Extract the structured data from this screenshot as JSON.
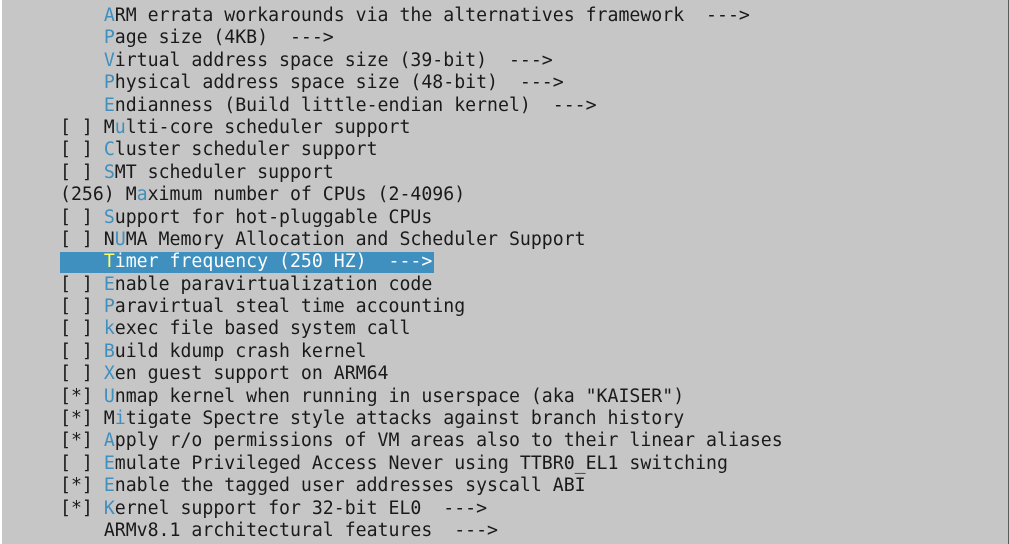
{
  "colors": {
    "background": "#c6c6c6",
    "text": "#1a1a1a",
    "hotkey": "#3f8fbf",
    "selection": "#3f8fbf",
    "selection_text": "#ffffff",
    "selection_hotkey": "#ffff66"
  },
  "items": [
    {
      "prefix": "    ",
      "hot": "A",
      "rest": "RM errata workarounds via the alternatives framework  --->",
      "selected": false
    },
    {
      "prefix": "    ",
      "hot": "P",
      "rest": "age size (4KB)  --->",
      "selected": false
    },
    {
      "prefix": "    ",
      "hot": "V",
      "rest": "irtual address space size (39-bit)  --->",
      "selected": false
    },
    {
      "prefix": "    ",
      "hot": "P",
      "rest": "hysical address space size (48-bit)  --->",
      "selected": false
    },
    {
      "prefix": "    ",
      "hot": "E",
      "rest": "ndianness (Build little-endian kernel)  --->",
      "selected": false
    },
    {
      "prefix": "[ ] M",
      "hot": "u",
      "rest": "lti-core scheduler support",
      "selected": false
    },
    {
      "prefix": "[ ] ",
      "hot": "C",
      "rest": "luster scheduler support",
      "selected": false
    },
    {
      "prefix": "[ ] ",
      "hot": "S",
      "rest": "MT scheduler support",
      "selected": false
    },
    {
      "prefix": "(256) M",
      "hot": "a",
      "rest": "ximum number of CPUs (2-4096)",
      "selected": false
    },
    {
      "prefix": "[ ] ",
      "hot": "S",
      "rest": "upport for hot-pluggable CPUs",
      "selected": false
    },
    {
      "prefix": "[ ] N",
      "hot": "U",
      "rest": "MA Memory Allocation and Scheduler Support",
      "selected": false
    },
    {
      "prefix": "    ",
      "hot": "T",
      "rest": "imer frequency (250 HZ)  --->",
      "selected": true
    },
    {
      "prefix": "[ ] ",
      "hot": "E",
      "rest": "nable paravirtualization code",
      "selected": false
    },
    {
      "prefix": "[ ] ",
      "hot": "P",
      "rest": "aravirtual steal time accounting",
      "selected": false
    },
    {
      "prefix": "[ ] ",
      "hot": "k",
      "rest": "exec file based system call",
      "selected": false
    },
    {
      "prefix": "[ ] ",
      "hot": "B",
      "rest": "uild kdump crash kernel",
      "selected": false
    },
    {
      "prefix": "[ ] ",
      "hot": "X",
      "rest": "en guest support on ARM64",
      "selected": false
    },
    {
      "prefix": "[*] ",
      "hot": "U",
      "rest": "nmap kernel when running in userspace (aka \"KAISER\")",
      "selected": false
    },
    {
      "prefix": "[*] M",
      "hot": "i",
      "rest": "tigate Spectre style attacks against branch history",
      "selected": false
    },
    {
      "prefix": "[*] ",
      "hot": "A",
      "rest": "pply r/o permissions of VM areas also to their linear aliases",
      "selected": false
    },
    {
      "prefix": "[ ] ",
      "hot": "E",
      "rest": "mulate Privileged Access Never using TTBR0_EL1 switching",
      "selected": false
    },
    {
      "prefix": "[*] ",
      "hot": "E",
      "rest": "nable the tagged user addresses syscall ABI",
      "selected": false
    },
    {
      "prefix": "[*] ",
      "hot": "K",
      "rest": "ernel support for 32-bit EL0  --->",
      "selected": false
    },
    {
      "prefix": "    ",
      "hot": "",
      "rest": "ARMv8.1 architectural features  --->",
      "selected": false
    }
  ]
}
